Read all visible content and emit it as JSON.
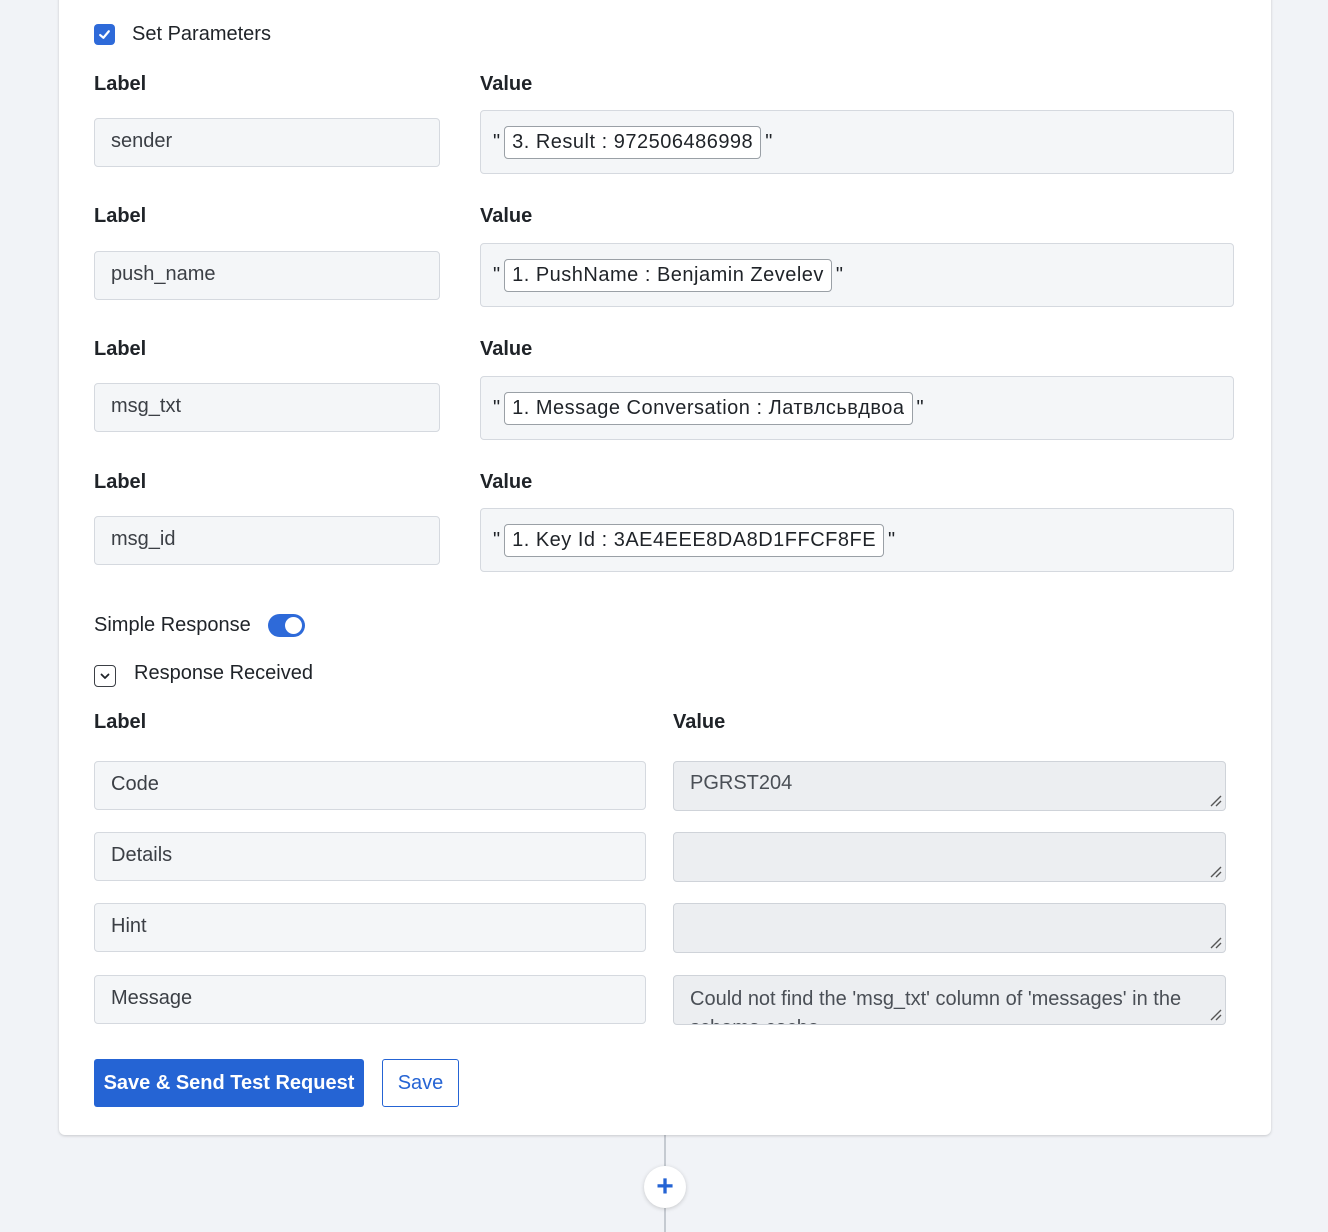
{
  "set_parameters": {
    "checkbox_checked": true,
    "label": "Set Parameters",
    "rows": [
      {
        "label_heading": "Label",
        "value_heading": "Value",
        "label": "sender",
        "chip": "3. Result : 972506486998"
      },
      {
        "label_heading": "Label",
        "value_heading": "Value",
        "label": "push_name",
        "chip": "1. PushName : Benjamin Zevelev"
      },
      {
        "label_heading": "Label",
        "value_heading": "Value",
        "label": "msg_txt",
        "chip": "1. Message Conversation : Латвлсьвдвоа"
      },
      {
        "label_heading": "Label",
        "value_heading": "Value",
        "label": "msg_id",
        "chip": "1. Key Id : 3AE4EEE8DA8D1FFCF8FE"
      }
    ],
    "quote_char": "\""
  },
  "simple_response": {
    "label": "Simple Response",
    "enabled": true
  },
  "response_received": {
    "label": "Response Received",
    "label_heading": "Label",
    "value_heading": "Value",
    "rows": [
      {
        "label": "Code",
        "value": "PGRST204"
      },
      {
        "label": "Details",
        "value": ""
      },
      {
        "label": "Hint",
        "value": ""
      },
      {
        "label": "Message",
        "value": "Could not find the 'msg_txt' column of 'messages' in the schema cache"
      }
    ]
  },
  "buttons": {
    "save_send": "Save & Send Test Request",
    "save": "Save"
  },
  "add_step": {
    "icon": "+"
  },
  "colors": {
    "accent": "#2564d4",
    "background": "#f1f3f7"
  }
}
